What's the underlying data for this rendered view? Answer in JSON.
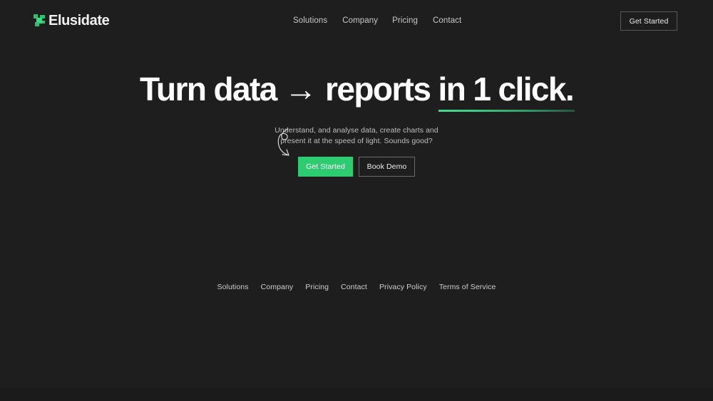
{
  "theme": {
    "background": "#1e1e1e",
    "accent_green": "#2ecc71",
    "logo_green": "#3ddc84",
    "text_primary": "#ffffff",
    "text_muted": "#c9c9c9"
  },
  "header": {
    "brand": {
      "name": "Elusidate",
      "logo_icon": "pixel-squares-logo-icon"
    },
    "nav": [
      {
        "label": "Solutions"
      },
      {
        "label": "Company"
      },
      {
        "label": "Pricing"
      },
      {
        "label": "Contact"
      }
    ],
    "cta": {
      "label": "Get Started"
    }
  },
  "hero": {
    "headline": {
      "part1": "Turn data ",
      "arrow": "→",
      "part2": " reports ",
      "accent": "in 1 click."
    },
    "subtext_line1": "Understand, and analyse data, create charts and",
    "subtext_line2": "present it at the speed of light. Sounds good?",
    "decoration": "curly-arrow-icon",
    "primary_cta": {
      "label": "Get Started"
    },
    "secondary_cta": {
      "label": "Book Demo"
    }
  },
  "footer": {
    "links": [
      {
        "label": "Solutions"
      },
      {
        "label": "Company"
      },
      {
        "label": "Pricing"
      },
      {
        "label": "Contact"
      },
      {
        "label": "Privacy Policy"
      },
      {
        "label": "Terms of Service"
      }
    ]
  }
}
